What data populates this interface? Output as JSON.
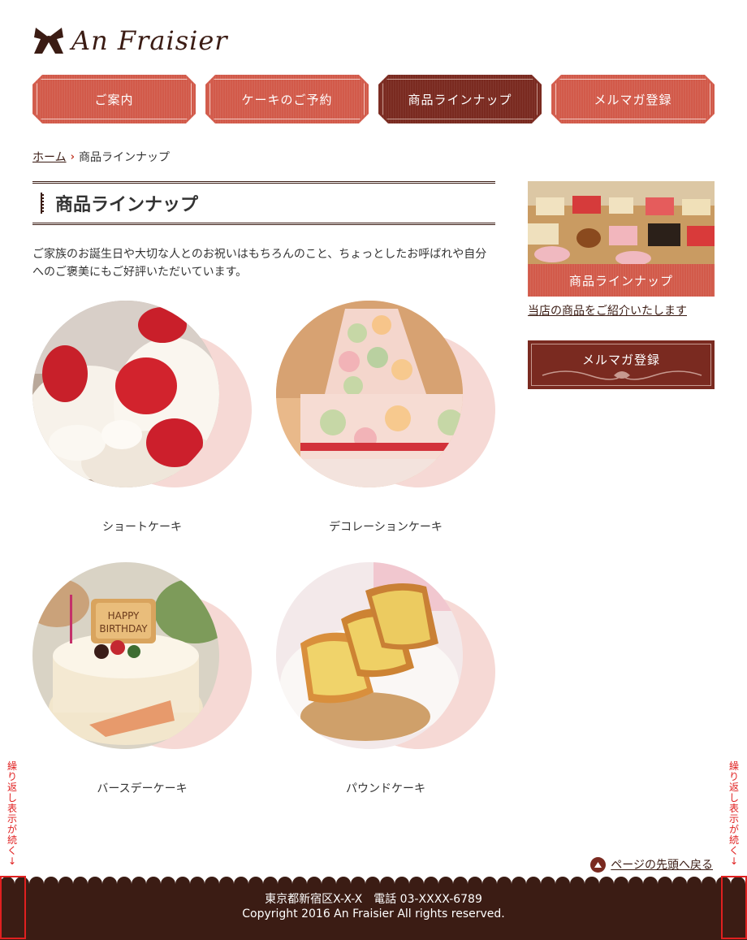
{
  "logo": {
    "text": "An Fraisier",
    "icon": "ribbon-bow-icon"
  },
  "nav": [
    {
      "label": "ご案内",
      "active": false
    },
    {
      "label": "ケーキのご予約",
      "active": false
    },
    {
      "label": "商品ラインナップ",
      "active": true
    },
    {
      "label": "メルマガ登録",
      "active": false
    }
  ],
  "breadcrumb": {
    "home": "ホーム",
    "current": "商品ラインナップ"
  },
  "main": {
    "title": "商品ラインナップ",
    "intro": "ご家族のお誕生日や大切な人とのお祝いはもちろんのこと、ちょっとしたお呼ばれや自分へのご褒美にもご好評いただいています。",
    "products": [
      {
        "name": "ショートケーキ"
      },
      {
        "name": "デコレーションケーキ"
      },
      {
        "name": "バースデーケーキ"
      },
      {
        "name": "パウンドケーキ"
      }
    ]
  },
  "sidebar": {
    "banner_label": "商品ラインナップ",
    "link_text": "当店の商品をご紹介いたします",
    "mail_label": "メルマガ登録"
  },
  "back_to_top": "ページの先頭へ戻る",
  "footer": {
    "address": "東京都新宿区X-X-X　電話 03-XXXX-6789",
    "copyright": "Copyright 2016 An Fraisier All rights reserved."
  },
  "annotation": "繰り返し表示が続く",
  "colors": {
    "accent": "#d25a4a",
    "accent_dark": "#7a2a20",
    "brown": "#3b1c14",
    "pink": "#f6d9d5"
  }
}
